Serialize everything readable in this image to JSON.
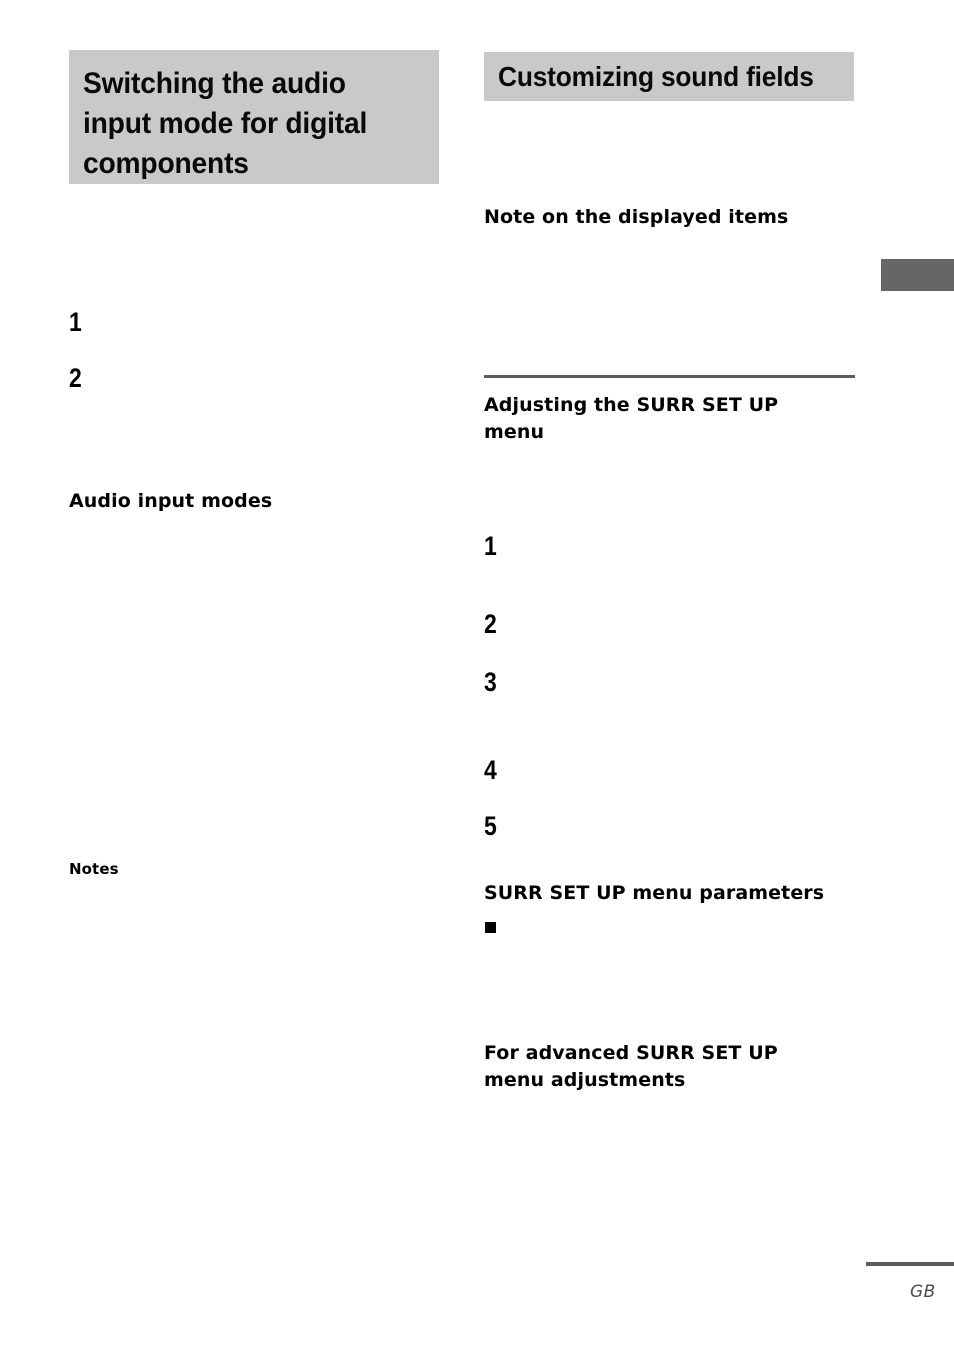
{
  "page": {
    "language_code": "GB",
    "background_color": "#ffffff",
    "banner_fill": "#c9c9c9",
    "rule_color": "#5d5d5d",
    "tab_color": "#666666"
  },
  "left_column": {
    "banner_heading": "Switching the audio input mode for digital components",
    "steps": [
      {
        "number": "1"
      },
      {
        "number": "2"
      }
    ],
    "subheadings": [
      {
        "text": "Audio input modes"
      },
      {
        "text": "Notes"
      }
    ]
  },
  "right_column": {
    "banner_heading": "Customizing sound fields",
    "note_heading": "Note on the displayed items",
    "adjusting_heading_line1": "Adjusting the SURR SET UP",
    "adjusting_heading_line2": "menu",
    "steps": [
      {
        "number": "1"
      },
      {
        "number": "2"
      },
      {
        "number": "3"
      },
      {
        "number": "4"
      },
      {
        "number": "5"
      }
    ],
    "parameters_heading": "SURR SET UP menu parameters",
    "advanced_heading_line1": "For advanced SURR SET UP",
    "advanced_heading_line2": "menu adjustments"
  }
}
